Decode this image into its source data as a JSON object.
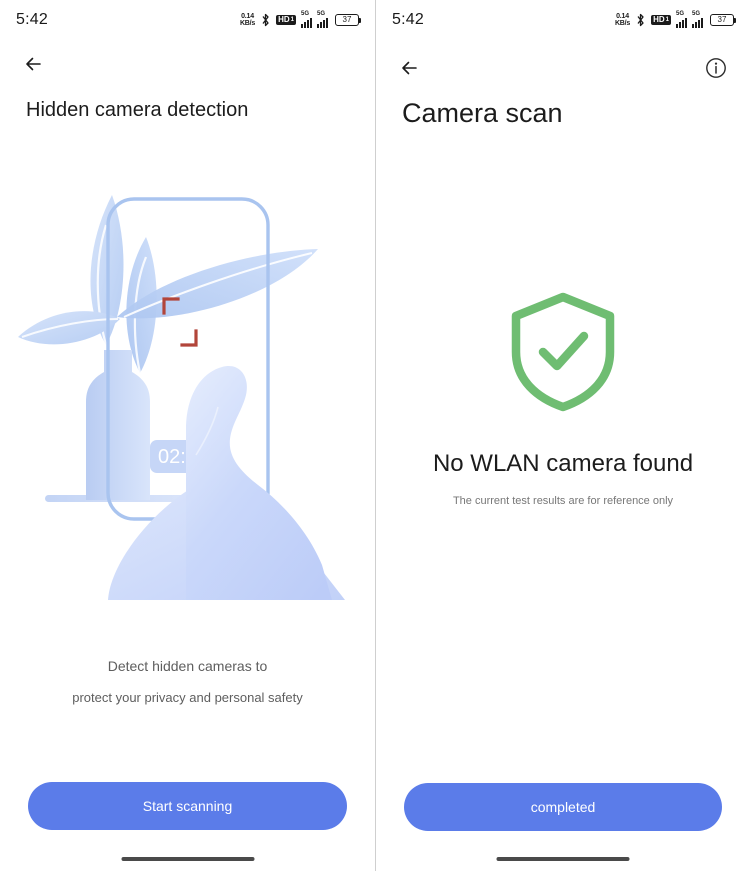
{
  "status_bar": {
    "time": "5:42",
    "net_speed_value": "0.14",
    "net_speed_unit": "KB/s",
    "bluetooth_icon": "bluetooth-icon",
    "hd_label": "HD",
    "hd_sub": "1",
    "signal1_label": "5G",
    "signal2_label": "5G",
    "battery_percent": "37"
  },
  "left_screen": {
    "back_icon": "back-arrow-icon",
    "title": "Hidden camera detection",
    "illustration": {
      "timer_badge": "02:36",
      "focus_bracket_color": "#b2453a",
      "phone_outline_color": "#a9c4ef",
      "leaf_color": "#c3d6f5",
      "hand_color": "#c9d6f8"
    },
    "caption_line1": "Detect hidden cameras to",
    "caption_line2": "protect your privacy and personal safety",
    "primary_button": "Start scanning"
  },
  "right_screen": {
    "back_icon": "back-arrow-icon",
    "info_icon": "info-circle-icon",
    "title": "Camera scan",
    "shield_icon": "shield-check-icon",
    "shield_color": "#6fbd72",
    "result_title": "No WLAN camera found",
    "result_subtitle": "The current test results are for reference only",
    "primary_button": "completed"
  },
  "theme": {
    "accent": "#5b7ce9",
    "success": "#6fbd72",
    "text_primary": "#1c1c1c",
    "text_secondary": "#5e5e5e",
    "text_muted": "#777777",
    "background": "#ffffff"
  }
}
